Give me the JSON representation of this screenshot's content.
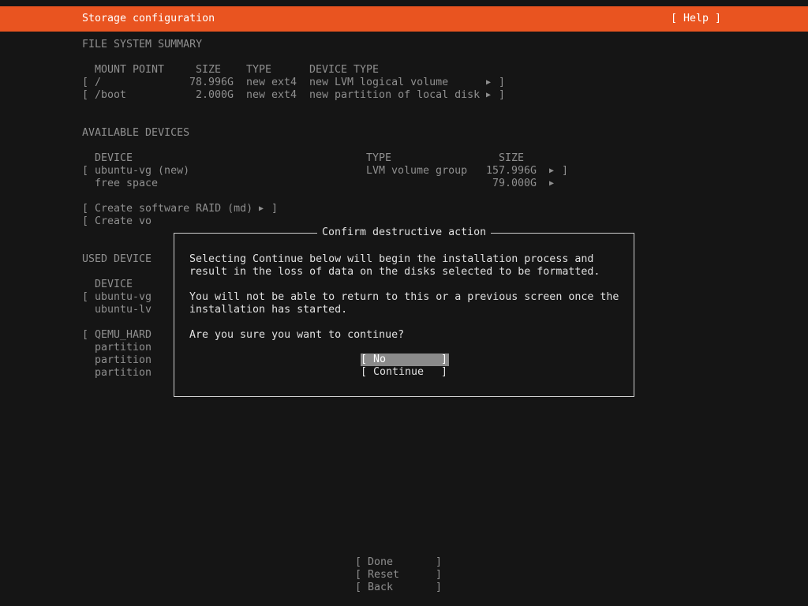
{
  "header": {
    "title": "Storage configuration",
    "help": "[ Help ]"
  },
  "fs_summary": {
    "heading": "FILE SYSTEM SUMMARY",
    "columns": [
      "MOUNT POINT",
      "SIZE",
      "TYPE",
      "DEVICE TYPE"
    ],
    "rows": [
      {
        "mount": "/",
        "size": "78.996G",
        "type": "new ext4",
        "device_type": "new LVM logical volume"
      },
      {
        "mount": "/boot",
        "size": "2.000G",
        "type": "new ext4",
        "device_type": "new partition of local disk"
      }
    ]
  },
  "available_devices": {
    "heading": "AVAILABLE DEVICES",
    "columns": [
      "DEVICE",
      "TYPE",
      "SIZE"
    ],
    "rows": [
      {
        "device": "ubuntu-vg (new)",
        "type": "LVM volume group",
        "size": "157.996G"
      },
      {
        "device": "free space",
        "type": "",
        "size": "79.000G"
      }
    ],
    "actions": [
      "Create software RAID (md)",
      "Create vo"
    ]
  },
  "used_devices": {
    "heading": "USED DEVICE",
    "column": "DEVICE",
    "items": [
      "ubuntu-vg",
      "ubuntu-lv",
      "QEMU_HARD",
      "partition",
      "partition",
      "partition"
    ]
  },
  "dialog": {
    "title": "Confirm destructive action",
    "lines": [
      "Selecting Continue below will begin the installation process and",
      "result in the loss of data on the disks selected to be formatted.",
      "You will not be able to return to this or a previous screen once the",
      "installation has started.",
      "Are you sure you want to continue?"
    ],
    "buttons": {
      "no": "[ No",
      "continue": "[ Continue"
    }
  },
  "footer": {
    "buttons": [
      "[ Done",
      "[ Reset",
      "[ Back"
    ]
  },
  "colors": {
    "accent": "#e95420",
    "background": "#151515",
    "text": "#8f8f8f",
    "highlight": "#8a8a8a"
  },
  "icons": {
    "expand": "right-triangle-icon"
  }
}
